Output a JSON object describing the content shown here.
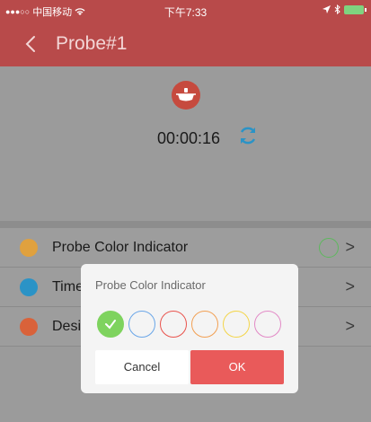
{
  "status_bar": {
    "signal": "●●●○○",
    "carrier": "中国移动",
    "wifi_icon": "wifi-icon",
    "time": "下午7:33",
    "location_icon": "location-arrow-icon",
    "bluetooth_icon": "bluetooth-icon",
    "battery_icon": "battery-charging-icon"
  },
  "nav": {
    "back_icon": "chevron-left-icon",
    "title": "Probe#1"
  },
  "probe": {
    "icon": "probe-grill-icon",
    "timer": "00:00:16",
    "refresh_icon": "refresh-icon"
  },
  "settings": [
    {
      "label": "Probe Color Indicator",
      "icon": "palette-icon",
      "icon_color": "#e0a13e"
    },
    {
      "label": "Time",
      "icon": "clock-icon",
      "icon_color": "#2b93c6"
    },
    {
      "label": "Desi",
      "icon": "bell-icon",
      "icon_color": "#d9623a"
    }
  ],
  "dialog": {
    "title": "Probe Color Indicator",
    "colors": [
      "#7ed35e",
      "#6aa6e8",
      "#e9534d",
      "#f2a053",
      "#f3d54a",
      "#e28ac6"
    ],
    "selected_index": 0,
    "cancel_label": "Cancel",
    "ok_label": "OK"
  },
  "colors": {
    "header": "#b84a4a",
    "accent": "#e95a5a",
    "refresh": "#2b93c6"
  }
}
